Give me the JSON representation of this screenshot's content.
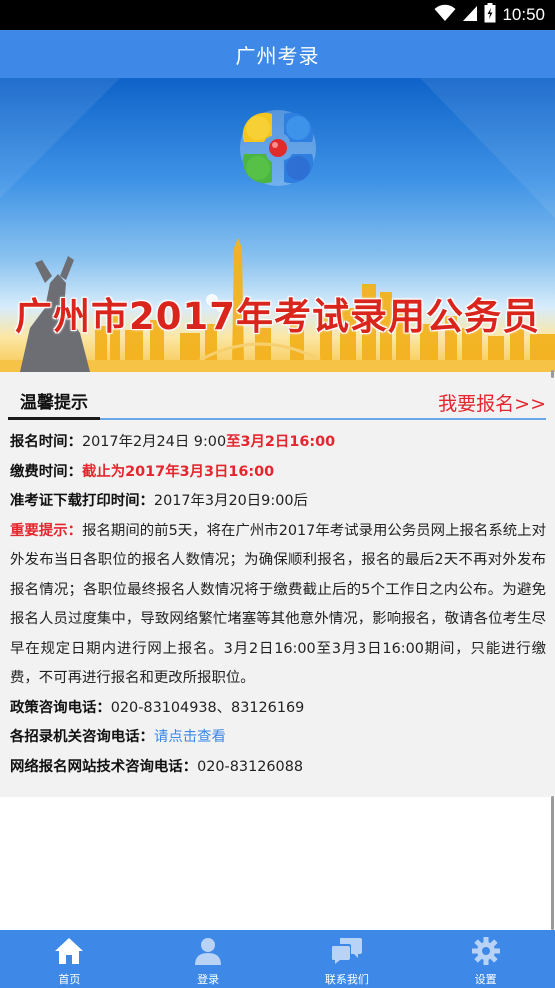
{
  "status_bar": {
    "time": "10:50",
    "icons": [
      "wifi-icon",
      "signal-icon",
      "battery-icon"
    ]
  },
  "app_bar": {
    "title": "广州考录"
  },
  "banner": {
    "title": "广州市2017年考试录用公务员"
  },
  "notice": {
    "tab_label": "温馨提示",
    "signup_link": "我要报名>>",
    "reg_time": {
      "label": "报名时间：",
      "value_start": "2017年2月24日 9:00",
      "value_end": "至3月2日16:00"
    },
    "pay_time": {
      "label": "缴费时间：",
      "value": "截止为2017年3月3日16:00"
    },
    "admit_time": {
      "label": "准考证下载打印时间：",
      "value": "2017年3月20日9:00后"
    },
    "important": {
      "label": "重要提示：",
      "text": "报名期间的前5天，将在广州市2017年考试录用公务员网上报名系统上对外发布当日各职位的报名人数情况；为确保顺利报名，报名的最后2天不再对外发布报名情况；各职位最终报名人数情况将于缴费截止后的5个工作日之内公布。为避免报名人员过度集中，导致网络繁忙堵塞等其他意外情况，影响报名，敬请各位考生尽早在规定日期内进行网上报名。3月2日16:00至3月3日16:00期间，只能进行缴费，不可再进行报名和更改所报职位。"
    },
    "policy_phone": {
      "label": "政策咨询电话：",
      "value": "020-83104938、83126169"
    },
    "agency_phone": {
      "label": "各招录机关咨询电话：",
      "link": "请点击查看"
    },
    "tech_phone": {
      "label": "网络报名网站技术咨询电话：",
      "value": "020-83126088"
    }
  },
  "bottom_nav": {
    "items": [
      {
        "label": "首页",
        "icon": "home-icon"
      },
      {
        "label": "登录",
        "icon": "user-icon"
      },
      {
        "label": "联系我们",
        "icon": "chat-icon"
      },
      {
        "label": "设置",
        "icon": "gear-icon"
      }
    ]
  },
  "colors": {
    "primary": "#3e89e8",
    "accent_red": "#e5262e",
    "link_blue": "#3d87e6"
  }
}
